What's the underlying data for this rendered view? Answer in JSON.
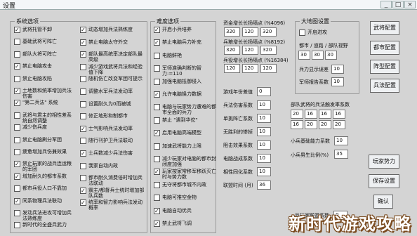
{
  "window": {
    "title": "设置",
    "buttons": [
      "×",
      "□",
      "_"
    ]
  },
  "system": {
    "title": "系统选项",
    "col1": [
      {
        "label": "武将托管不卸",
        "checked": true
      },
      {
        "label": "基础武将可阵亡",
        "checked": false
      },
      {
        "label": "部队大将可阵亡",
        "checked": false
      },
      {
        "label": "禁止电脑攻击",
        "checked": true
      },
      {
        "label": "禁止电脑攻陷",
        "checked": false
      },
      {
        "label": "土地数和统率增加兵法伤害",
        "checked": true
      },
      {
        "label": "\"第二兵法\" 系统",
        "checked": true
      },
      {
        "label": "武将与君主的相性差系统自然调整",
        "checked": false
      },
      {
        "label": "减少伤兵度",
        "checked": false
      },
      {
        "label": "禁止电脑刷分军团",
        "checked": false
      },
      {
        "label": "疲惫增加兵伤兼效果",
        "checked": false
      },
      {
        "label": "禁止玩家的战兵连运粮的军团",
        "checked": true
      },
      {
        "label": "增加耐久的都市系数",
        "checked": true
      },
      {
        "label": "都市兵役人口不靠加",
        "checked": false
      },
      {
        "label": "同系物理兵法联动",
        "checked": true
      },
      {
        "label": "发动兵法进攻可增加兵法熟练度",
        "checked": false
      },
      {
        "label": "新时代的全盛兵武力",
        "checked": false
      }
    ],
    "col2": [
      {
        "label": "动态增加兵法熟练度",
        "checked": true
      },
      {
        "label": "禁止电脑太守外交",
        "checked": true
      },
      {
        "label": "部队最高统率决定部队最高级",
        "checked": true
      },
      {
        "label": "减少游戏武将兵法和经验值下降",
        "checked": false
      },
      {
        "label": "随机伤亡改变军团可提示",
        "checked": false
      },
      {
        "label": "调整水军兵法发动率",
        "checked": false
      },
      {
        "label": "设置耐久为0而被城",
        "checked": false
      },
      {
        "label": "修正地形和制都市",
        "checked": false
      },
      {
        "label": "士气影响兵法发动率",
        "checked": true
      },
      {
        "label": "随行刊护卫兵法联动",
        "checked": false
      },
      {
        "label": "士兵数减少兵法伤害",
        "checked": true
      },
      {
        "label": "我家自动内政",
        "checked": false
      },
      {
        "label": "都市耐久消费倍时增加兵法联动",
        "checked": false
      },
      {
        "label": "霸主/都督兵士统时增加部队兵数",
        "checked": true
      },
      {
        "label": "统率和智力影响兵法发动概率",
        "checked": true
      }
    ]
  },
  "difficulty": {
    "title": "难度选项",
    "items": [
      {
        "label": "开启小兵培养",
        "checked": true
      },
      {
        "label": "禁止电脑兵力补充",
        "checked": true
      },
      {
        "label": "电脑鲜艳",
        "checked": false
      },
      {
        "label": "军师准确判断的智力:=110",
        "checked": false
      },
      {
        "label": "加强电脑抵御侵入",
        "checked": false
      },
      {
        "label": "允许电脑换力数据",
        "checked": true
      },
      {
        "label": "电脑与玩家势力遭难的都市全面的兵力",
        "checked": false
      },
      {
        "label": "禁止 \"遇到华佗\"",
        "checked": false
      },
      {
        "label": "启用电脑高端模型",
        "checked": true
      },
      {
        "label": "加速武将能力上限",
        "checked": false
      },
      {
        "label": "减少玩家对电脑的都市封闭度加强",
        "checked": false
      },
      {
        "label": "玩家按家常移军移跃灭亡时与势力数",
        "checked": true
      },
      {
        "label": "无守将都市城不内政",
        "checked": false
      },
      {
        "label": "电脑可推空金物",
        "checked": false
      },
      {
        "label": "电脑自动优兵",
        "checked": true
      },
      {
        "label": "禁止武将飞调",
        "checked": true
      }
    ]
  },
  "params": {
    "assets_label": "资金增长长扬隔点 (%4096)",
    "assets_vals": [
      "320",
      "120",
      "320"
    ],
    "troops_label": "兵粮增长长扬隔点 (%8192)",
    "troops_vals": [
      "320",
      "120",
      "320"
    ],
    "soldiers_label": "兵役增长长扬隔点 (%16384)",
    "soldiers_vals": [
      "120",
      "120",
      "120"
    ],
    "rows": [
      {
        "label": "游戏年份差值",
        "value": "0"
      },
      {
        "label": "兵法伤害系数",
        "value": "10"
      },
      {
        "label": "单挑阵亡系数",
        "value": "10"
      },
      {
        "label": "无胜利的惨掉",
        "value": "10"
      },
      {
        "label": "阻击效果系数",
        "value": "10"
      },
      {
        "label": "电脑战成系数",
        "value": "10"
      },
      {
        "label": "相性同化系数",
        "value": "10"
      },
      {
        "label": "联盟时间 (月)",
        "value": "36"
      }
    ],
    "battle_label": "部队武将的兵法触发率系数",
    "battle_vals": [
      "20",
      "16",
      "16",
      "16"
    ],
    "battle_vals2": [
      "16",
      "20",
      "20",
      "20"
    ],
    "small_attack_label": "小兵基础能力系数",
    "small_attack_val": "10",
    "small_male_label": "小兵男生比例(%)",
    "small_male_val": "35",
    "reverse_label": "反玩家联盟系数",
    "reverse_val": "0"
  },
  "map": {
    "title": "大地图设置",
    "enable_label": "开启进攻",
    "enable_checked": false,
    "map_city_label": "都市 / 道路 / 部队视野",
    "map_vals": [
      "30",
      "30",
      "30"
    ],
    "attack_label": "兵力显示误差",
    "attack_val": "10",
    "army_label": "军师报告系数",
    "army_val": "10"
  },
  "buttons": {
    "general": "武将配置",
    "city": "都市配置",
    "formation": "阵型配置",
    "strategy": "兵法配置",
    "player_power": "玩家势力",
    "save": "保存设置",
    "ok": "确认"
  },
  "watermark": "新时代游戏攻略"
}
